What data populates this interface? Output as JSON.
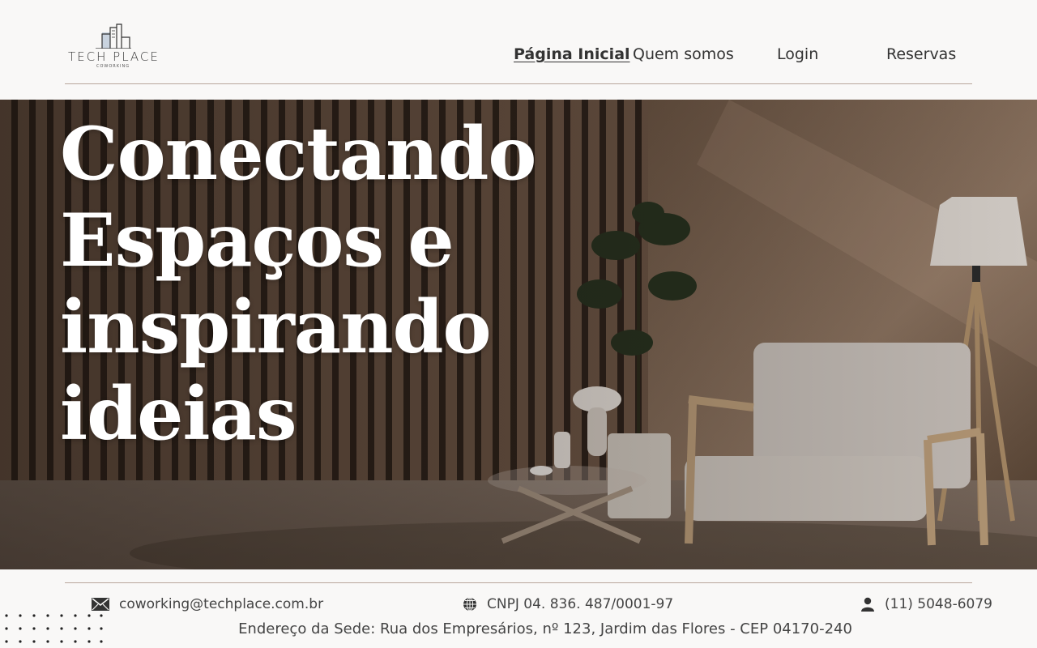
{
  "brand": {
    "name": "TECH PLACE",
    "tagline": "COWORKING"
  },
  "nav": {
    "items": [
      {
        "label": "Página Inicial",
        "active": true
      },
      {
        "label": "Quem somos",
        "active": false
      },
      {
        "label": "Login",
        "active": false
      },
      {
        "label": "Reservas",
        "active": false
      }
    ]
  },
  "hero": {
    "title_lines": [
      "Conectando",
      "Espaços e",
      "inspirando",
      "ideias"
    ]
  },
  "footer": {
    "email": "coworking@techplace.com.br",
    "cnpj": "CNPJ 04. 836. 487/0001-97",
    "phone": "(11) 5048-6079",
    "address": "Endereço da Sede: Rua dos Empresários, nº 123, Jardim das Flores - CEP 04170-240"
  },
  "icons": {
    "email": "mail-icon",
    "cnpj": "globe-icon",
    "phone": "user-icon"
  },
  "colors": {
    "background": "#f9f8f7",
    "divider": "#b8a79b",
    "hero_text": "#ffffff",
    "text": "#333333"
  }
}
